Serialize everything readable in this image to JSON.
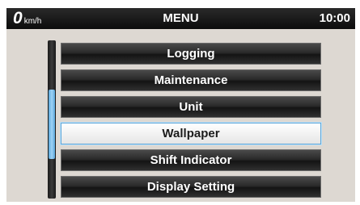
{
  "header": {
    "speed_value": "0",
    "speed_unit": "km/h",
    "title": "MENU",
    "clock": "10:00"
  },
  "menu": {
    "items": [
      {
        "label": "Logging",
        "selected": false
      },
      {
        "label": "Maintenance",
        "selected": false
      },
      {
        "label": "Unit",
        "selected": false
      },
      {
        "label": "Wallpaper",
        "selected": true
      },
      {
        "label": "Shift Indicator",
        "selected": false
      },
      {
        "label": "Display Setting",
        "selected": false
      }
    ]
  },
  "scrollbar": {
    "thumb_start_fraction": 0.31,
    "thumb_length_fraction": 0.44
  },
  "colors": {
    "selection_border": "#5fa7d9",
    "scroll_thumb": "#9fd3f5",
    "header_bg": "#0c0c0c",
    "screen_bg": "#ddd8d2"
  }
}
